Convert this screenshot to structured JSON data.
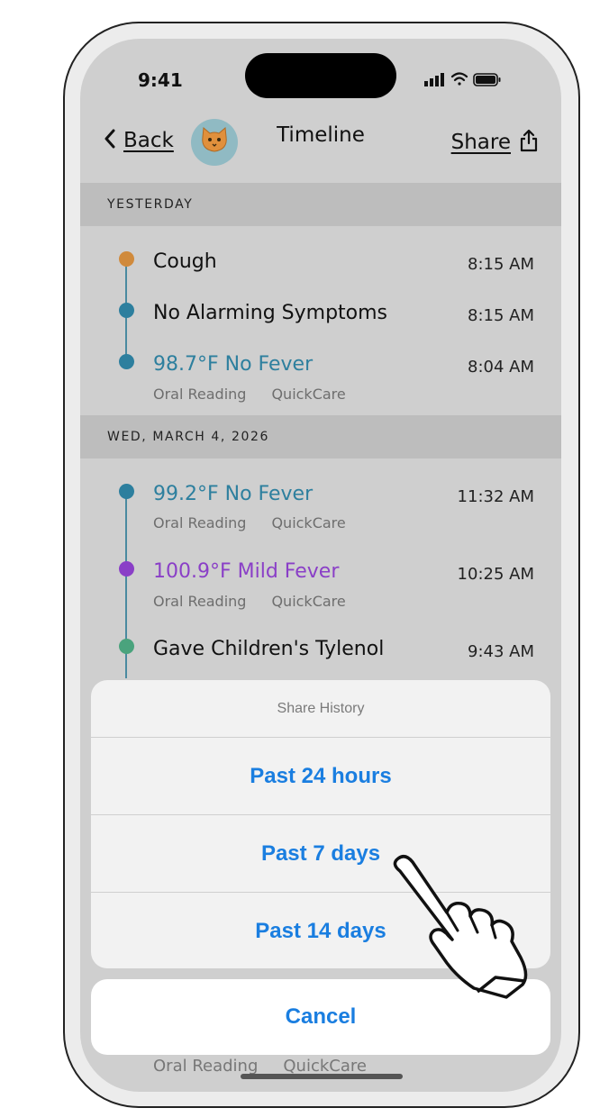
{
  "status_bar": {
    "time": "9:41"
  },
  "nav": {
    "back_label": "Back",
    "title": "Timeline",
    "share_label": "Share"
  },
  "sections": [
    {
      "header": "YESTERDAY",
      "events": [
        {
          "label": "Cough",
          "time": "8:15 AM",
          "color": "#d08a3c"
        },
        {
          "label": "No Alarming Symptoms",
          "time": "8:15 AM",
          "color": "#2d7f9e"
        },
        {
          "label": "98.7°F No Fever",
          "time": "8:04 AM",
          "color": "#2d7f9e",
          "sub": [
            "Oral Reading",
            "QuickCare"
          ]
        }
      ]
    },
    {
      "header": "WED, MARCH 4, 2026",
      "events": [
        {
          "label": "99.2°F No Fever",
          "time": "11:32 AM",
          "color": "#2d7f9e",
          "sub": [
            "Oral Reading",
            "QuickCare"
          ]
        },
        {
          "label": "100.9°F Mild Fever",
          "time": "10:25 AM",
          "color": "#8a3fc7",
          "sub": [
            "Oral Reading",
            "QuickCare"
          ]
        },
        {
          "label": "Gave Children's Tylenol",
          "time": "9:43 AM",
          "color": "#4aa37d"
        }
      ]
    }
  ],
  "hidden_row": {
    "sub": [
      "Oral Reading",
      "QuickCare"
    ]
  },
  "share_sheet": {
    "title": "Share History",
    "options": [
      "Past 24 hours",
      "Past 7 days",
      "Past 14 days"
    ],
    "cancel": "Cancel"
  },
  "colors": {
    "accent_blue": "#1a7ee0",
    "teal": "#2d7f9e",
    "purple": "#8a3fc7",
    "orange": "#d08a3c",
    "green": "#4aa37d"
  },
  "icons": [
    "back-chevron-icon",
    "cat-avatar-icon",
    "share-icon",
    "signal-icon",
    "wifi-icon",
    "battery-icon",
    "pointing-hand-icon"
  ]
}
